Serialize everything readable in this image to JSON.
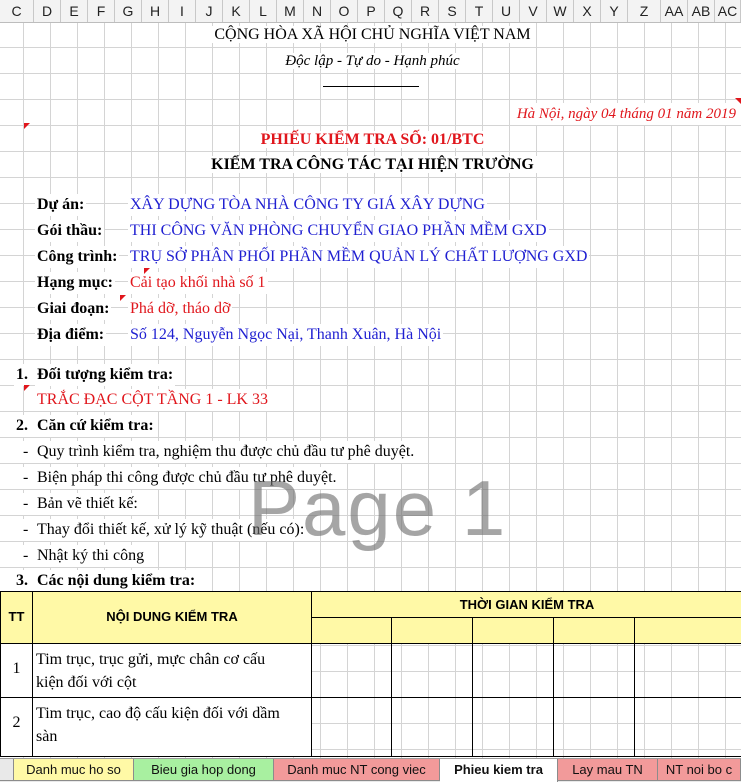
{
  "columns": [
    "C",
    "D",
    "E",
    "F",
    "G",
    "H",
    "I",
    "J",
    "K",
    "L",
    "M",
    "N",
    "O",
    "P",
    "Q",
    "R",
    "S",
    "T",
    "U",
    "V",
    "W",
    "X",
    "Y",
    "Z",
    "AA",
    "AB",
    "AC"
  ],
  "header": {
    "country": "CỘNG HÒA XÃ HỘI CHỦ NGHĨA VIỆT NAM",
    "motto": "Độc lập - Tự do - Hạnh phúc",
    "date_line": "Hà Nội, ngày 04 tháng 01 năm 2019"
  },
  "title": {
    "form_number": "PHIẾU KIỂM TRA SỐ: 01/BTC",
    "subject": "KIỂM TRA CÔNG TÁC TẠI HIỆN TRƯỜNG"
  },
  "info": [
    {
      "label": "Dự án:",
      "value": "XÂY DỰNG TÒA NHÀ CÔNG TY GIÁ XÂY DỰNG",
      "color": "#1f1fd1"
    },
    {
      "label": "Gói thầu:",
      "value": "THI CÔNG VĂN PHÒNG CHUYỂN GIAO PHẦN MỀM GXD",
      "color": "#1f1fd1"
    },
    {
      "label": "Công trình:",
      "value": "TRỤ SỞ PHÂN PHỐI PHẦN MỀM QUẢN LÝ CHẤT LƯỢNG GXD",
      "color": "#1f1fd1"
    },
    {
      "label": "Hạng mục:",
      "value": "Cải tạo khối nhà số 1",
      "color": "#e0161c"
    },
    {
      "label": "Giai đoạn:",
      "value": "Phá dỡ, tháo dỡ",
      "color": "#e0161c"
    },
    {
      "label": "Địa điểm:",
      "value": "Số 124, Nguyễn Ngọc Nại, Thanh Xuân, Hà Nội",
      "color": "#1f1fd1"
    }
  ],
  "section1": {
    "number": "1.",
    "heading": "Đối tượng kiểm tra:",
    "value": "TRẮC ĐẠC CỘT TẦNG 1 - LK 33"
  },
  "section2": {
    "number": "2.",
    "heading": "Căn cứ kiểm tra:",
    "items": [
      "Quy trình kiểm tra, nghiệm thu được chủ đầu tư phê duyệt.",
      "Biện pháp thi công được chủ đầu tư phê duyệt.",
      "Bản vẽ thiết kế:",
      "Thay đổi thiết kế, xử lý kỹ thuật (nếu có):",
      "Nhật ký thi công"
    ],
    "bullet": "-"
  },
  "section3": {
    "number": "3.",
    "heading": "Các nội dung kiểm tra:"
  },
  "table": {
    "col_tt": "TT",
    "col_content": "NỘI DUNG KIỂM TRA",
    "col_time": "THỜI GIAN KIỂM TRA",
    "rows": [
      {
        "tt": "1",
        "line1": "Tim trục, trục gửi, mực chân cơ cấu",
        "line2": "kiện đối với cột"
      },
      {
        "tt": "2",
        "line1": "Tim trục, cao độ cấu kiện đối với dầm",
        "line2": "sàn"
      }
    ]
  },
  "watermark": "Page 1",
  "tabs": [
    {
      "label": "Danh muc ho so",
      "color": "#fff9a6",
      "active": false
    },
    {
      "label": "Bieu gia hop dong",
      "color": "#a8f0a0",
      "active": false
    },
    {
      "label": "Danh muc NT cong viec",
      "color": "#f29a9a",
      "active": false
    },
    {
      "label": "Phieu kiem tra",
      "color": "#ffffff",
      "active": true
    },
    {
      "label": "Lay mau TN",
      "color": "#f29a9a",
      "active": false
    },
    {
      "label": "NT noi bo c",
      "color": "#f29a9a",
      "active": false
    }
  ]
}
